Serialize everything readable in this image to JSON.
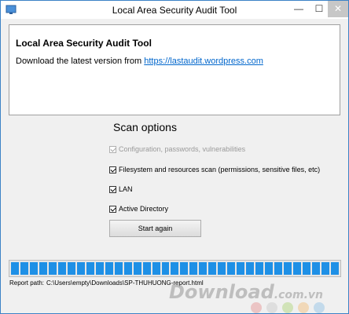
{
  "window": {
    "title": "Local Area Security Audit Tool",
    "minimize_label": "—",
    "maximize_label": "☐",
    "close_label": "✕"
  },
  "header": {
    "title": "Local Area Security Audit Tool",
    "download_text": "Download the latest version from ",
    "download_link": "https://lastaudit.wordpress.com"
  },
  "scan": {
    "title": "Scan options",
    "options": [
      {
        "label": "Configuration, passwords, vulnerabilities",
        "checked": true,
        "enabled": false
      },
      {
        "label": "Filesystem and resources scan (permissions, sensitive files, etc)",
        "checked": true,
        "enabled": true
      },
      {
        "label": "LAN",
        "checked": true,
        "enabled": true
      },
      {
        "label": "Active Directory",
        "checked": true,
        "enabled": true
      }
    ],
    "start_button": "Start again"
  },
  "progress": {
    "value_percent": 100,
    "segments": 35,
    "color": "#1e90e6"
  },
  "report": {
    "label": "Report path:",
    "path": "C:\\Users\\empty\\Downloads\\SP-THUHUONG-report.html"
  },
  "watermark": {
    "text": "Download",
    "domain": ".com.vn",
    "dot_colors": [
      "#e8a0a0",
      "#cfcfcf",
      "#b8d88a",
      "#f2c48a",
      "#9ec8e8"
    ]
  }
}
